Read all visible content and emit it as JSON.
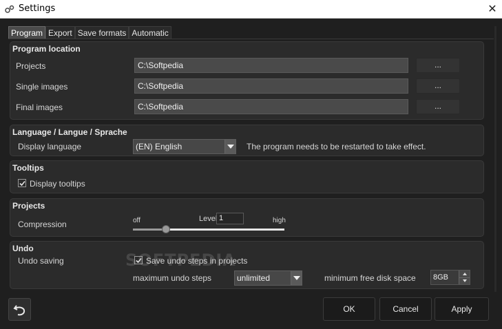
{
  "window": {
    "title": "Settings",
    "close_label": "✕"
  },
  "tabs": [
    {
      "label": "Program",
      "active": true
    },
    {
      "label": "Export",
      "active": false
    },
    {
      "label": "Save formats",
      "active": false
    },
    {
      "label": "Automatic",
      "active": false
    }
  ],
  "program_location": {
    "title": "Program location",
    "rows": [
      {
        "label": "Projects",
        "value": "C:\\Softpedia",
        "browse": "..."
      },
      {
        "label": "Single images",
        "value": "C:\\Softpedia",
        "browse": "..."
      },
      {
        "label": "Final images",
        "value": "C:\\Softpedia",
        "browse": "..."
      }
    ]
  },
  "language": {
    "title": "Language / Langue / Sprache",
    "label": "Display language",
    "selected": "(EN) English",
    "note": "The program needs to be restarted to take effect."
  },
  "tooltips": {
    "title": "Tooltips",
    "checkbox_label": "Display tooltips",
    "checked": true
  },
  "projects": {
    "title": "Projects",
    "compression_label": "Compression",
    "min_label": "off",
    "max_label": "high",
    "level_label": "Level",
    "level_value": "1",
    "slider_fraction": 0.22
  },
  "undo": {
    "title": "Undo",
    "saving_label": "Undo saving",
    "checkbox_label": "Save undo steps in projects",
    "checked": true,
    "max_steps_label": "maximum undo steps",
    "max_steps_value": "unlimited",
    "min_disk_label": "minimum free disk space",
    "min_disk_value": "8GB"
  },
  "buttons": {
    "ok": "OK",
    "cancel": "Cancel",
    "apply": "Apply"
  },
  "watermark": "SOFTPEDIA",
  "icons": {
    "app": "settings-app-icon",
    "undo": "undo-arrow-icon",
    "dropdown": "chevron-down-icon",
    "check": "checkmark-icon"
  }
}
